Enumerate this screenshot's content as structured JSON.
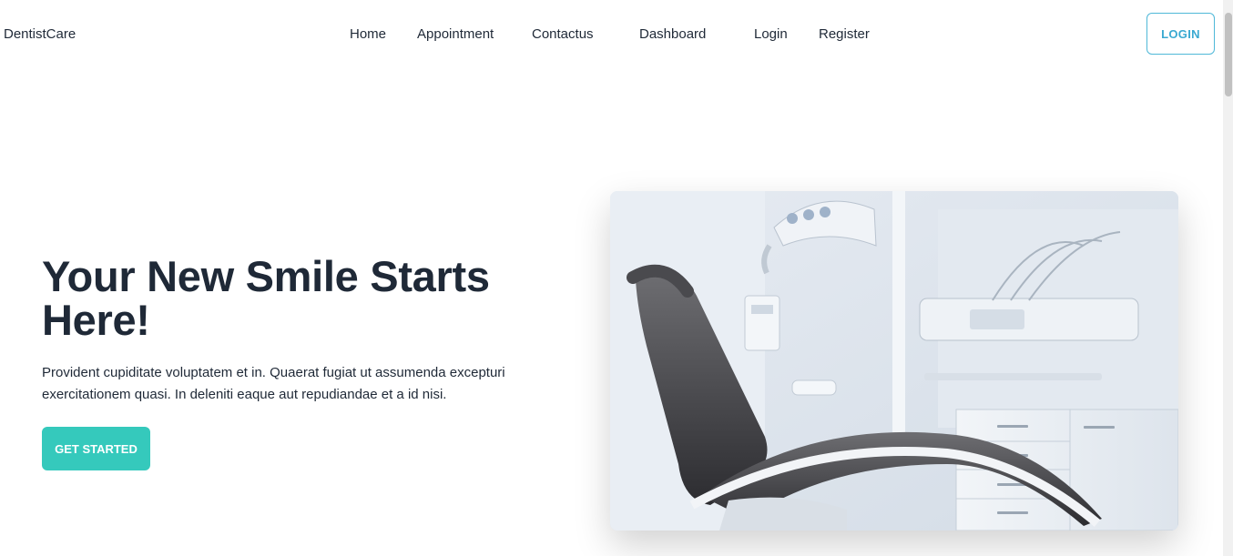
{
  "header": {
    "brand": "DentistCare",
    "nav": [
      "Home",
      "Appointment",
      "Contactus",
      "Dashboard",
      "Login",
      "Register"
    ],
    "login_button": "LOGIN"
  },
  "hero": {
    "title": "Your New Smile Starts Here!",
    "description": "Provident cupiditate voluptatem et in. Quaerat fugiat ut assumenda excepturi exercitationem quasi. In deleniti eaque aut repudiandae et a id nisi.",
    "cta": "GET STARTED",
    "image_subject": "dental-chair-photo"
  },
  "colors": {
    "accent": "#35c9bc",
    "login_border": "#4fb8d8",
    "text": "#1f2937"
  }
}
